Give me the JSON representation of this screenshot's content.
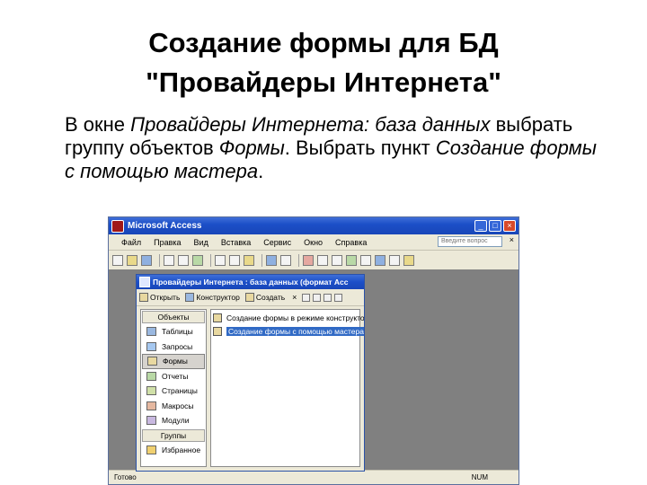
{
  "slide": {
    "title_line1": "Создание формы для БД",
    "title_line2": "\"Провайдеры Интернета\"",
    "body": [
      {
        "text": "В окне ",
        "italic": false
      },
      {
        "text": "Провайдеры Интернета: база данных",
        "italic": true
      },
      {
        "text": " выбрать группу объектов ",
        "italic": false
      },
      {
        "text": "Формы",
        "italic": true
      },
      {
        "text": ". Выбрать пункт ",
        "italic": false
      },
      {
        "text": "Создание формы с помощью мастера",
        "italic": true
      },
      {
        "text": ".",
        "italic": false
      }
    ]
  },
  "access": {
    "title": "Microsoft Access",
    "menu": [
      "Файл",
      "Правка",
      "Вид",
      "Вставка",
      "Сервис",
      "Окно",
      "Справка"
    ],
    "help_placeholder": "Введите вопрос",
    "status_left": "Готово",
    "status_right": "NUM"
  },
  "db_window": {
    "title": "Провайдеры Интернета : база данных (формат Acc",
    "toolbar": {
      "open": "Открыть",
      "design": "Конструктор",
      "create": "Создать",
      "delete": "×"
    },
    "objects_header": "Объекты",
    "objects": [
      {
        "label": "Таблицы",
        "icon": "table-icon",
        "color": "#9ab8e0"
      },
      {
        "label": "Запросы",
        "icon": "query-icon",
        "color": "#a6c8f0"
      },
      {
        "label": "Формы",
        "icon": "form-icon",
        "color": "#e8d8a0",
        "selected": true
      },
      {
        "label": "Отчеты",
        "icon": "report-icon",
        "color": "#b9d9a6"
      },
      {
        "label": "Страницы",
        "icon": "page-icon",
        "color": "#d0e0a8"
      },
      {
        "label": "Макросы",
        "icon": "macro-icon",
        "color": "#e5b8a0"
      },
      {
        "label": "Модули",
        "icon": "module-icon",
        "color": "#c8b8e0"
      }
    ],
    "groups_header": "Группы",
    "groups": [
      {
        "label": "Избранное",
        "icon": "favorites-icon",
        "color": "#f0d070"
      }
    ],
    "items": [
      {
        "label": "Создание формы в режиме конструктора",
        "selected": false
      },
      {
        "label": "Создание формы с помощью мастера",
        "selected": true
      }
    ]
  }
}
